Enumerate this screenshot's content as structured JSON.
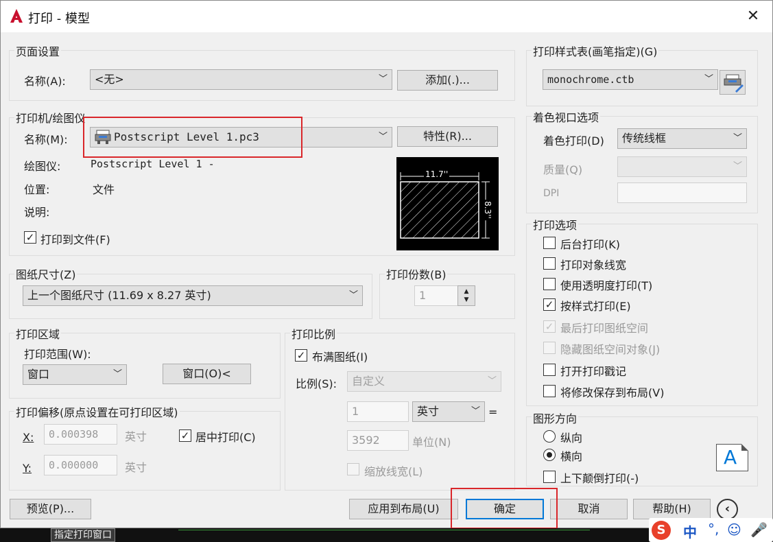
{
  "window": {
    "title": "打印 - 模型",
    "close_icon": "close-icon"
  },
  "page_setup": {
    "group_label": "页面设置",
    "name_label": "名称(A):",
    "name_value": "<无>",
    "add_button": "添加(.)..."
  },
  "printer": {
    "group_label": "打印机/绘图仪",
    "name_label": "名称(M):",
    "name_value": "Postscript Level 1.pc3",
    "properties_button": "特性(R)...",
    "plotter_label": "绘图仪:",
    "plotter_value": "Postscript Level 1 -",
    "location_label": "位置:",
    "location_value": "文件",
    "description_label": "说明:",
    "print_to_file_label": "打印到文件(F)",
    "print_to_file_checked": true,
    "preview_width": "11.7''",
    "preview_height": "8.3''"
  },
  "paper_size": {
    "group_label": "图纸尺寸(Z)",
    "value": "上一个图纸尺寸  (11.69 x 8.27 英寸)"
  },
  "copies": {
    "group_label": "打印份数(B)",
    "value": "1"
  },
  "plot_area": {
    "group_label": "打印区域",
    "range_label": "打印范围(W):",
    "range_value": "窗口",
    "window_button": "窗口(O)<"
  },
  "plot_offset": {
    "group_label": "打印偏移(原点设置在可打印区域)",
    "x_label": "X:",
    "x_value": "0.000398",
    "x_unit": "英寸",
    "y_label": "Y:",
    "y_value": "0.000000",
    "y_unit": "英寸",
    "center_label": "居中打印(C)",
    "center_checked": true
  },
  "plot_scale": {
    "group_label": "打印比例",
    "fit_label": "布满图纸(I)",
    "fit_checked": true,
    "scale_label": "比例(S):",
    "scale_value": "自定义",
    "value1": "1",
    "unit1": "英寸",
    "equals": "=",
    "value2": "3592",
    "unit2": "单位(N)",
    "lineweights_label": "缩放线宽(L)"
  },
  "plot_style": {
    "group_label": "打印样式表(画笔指定)(G)",
    "value": "monochrome.ctb",
    "edit_icon": "plot-style-edit-icon"
  },
  "shaded": {
    "group_label": "着色视口选项",
    "shade_label": "着色打印(D)",
    "shade_value": "传统线框",
    "quality_label": "质量(Q)",
    "quality_value": "",
    "dpi_label": "DPI",
    "dpi_value": ""
  },
  "options": {
    "group_label": "打印选项",
    "items": [
      {
        "label": "后台打印(K)",
        "checked": false,
        "disabled": false
      },
      {
        "label": "打印对象线宽",
        "checked": false,
        "disabled": false
      },
      {
        "label": "使用透明度打印(T)",
        "checked": false,
        "disabled": false
      },
      {
        "label": "按样式打印(E)",
        "checked": true,
        "disabled": false
      },
      {
        "label": "最后打印图纸空间",
        "checked": true,
        "disabled": true
      },
      {
        "label": "隐藏图纸空间对象(J)",
        "checked": false,
        "disabled": true
      },
      {
        "label": "打开打印戳记",
        "checked": false,
        "disabled": false
      },
      {
        "label": "将修改保存到布局(V)",
        "checked": false,
        "disabled": false
      }
    ]
  },
  "orientation": {
    "group_label": "图形方向",
    "portrait_label": "纵向",
    "landscape_label": "横向",
    "selected": "landscape",
    "upside_down_label": "上下颠倒打印(-)",
    "icon_letter": "A"
  },
  "footer": {
    "preview_button": "预览(P)...",
    "apply_button": "应用到布局(U)",
    "ok_button": "确定",
    "cancel_button": "取消",
    "help_button": "帮助(H)",
    "collapse_icon": "chevron-left-icon"
  },
  "taskbar": {
    "tip": "指定打印窗口",
    "ime_text": "中"
  },
  "colors": {
    "annotation_red": "#d9262a",
    "accent_blue": "#0078d7",
    "app_red": "#c8102e"
  }
}
